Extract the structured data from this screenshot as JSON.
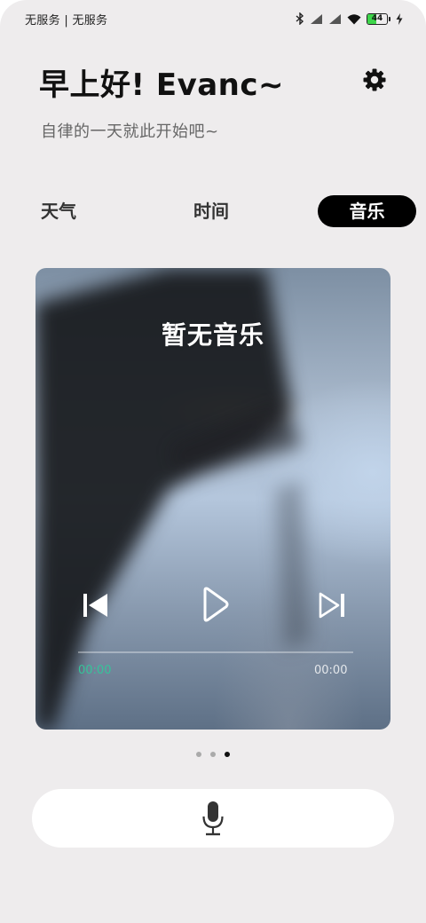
{
  "status_bar": {
    "carrier": "无服务 | 无服务",
    "battery": "44",
    "battery_level": 0.44,
    "icons": [
      "bluetooth-icon",
      "signal-icon",
      "signal-icon",
      "wifi-icon",
      "battery-icon",
      "charging-icon"
    ]
  },
  "header": {
    "greeting": "早上好! Evanc~",
    "subtitle": "自律的一天就此开始吧~",
    "settings_icon": "gear-icon"
  },
  "tabs": [
    {
      "label": "天气",
      "active": false
    },
    {
      "label": "时间",
      "active": false
    },
    {
      "label": "音乐",
      "active": true
    }
  ],
  "music_card": {
    "title": "暂无音乐",
    "current_time": "00:00",
    "total_time": "00:00",
    "progress": 0,
    "icons": [
      "previous-icon",
      "play-icon",
      "next-icon"
    ]
  },
  "pager": {
    "count": 3,
    "active_index": 2
  },
  "voice": {
    "icon": "microphone-icon"
  },
  "colors": {
    "background": "#eeeced",
    "accent_time": "#36c39a",
    "active_tab_bg": "#000000",
    "battery_fill": "#3dd54a"
  }
}
